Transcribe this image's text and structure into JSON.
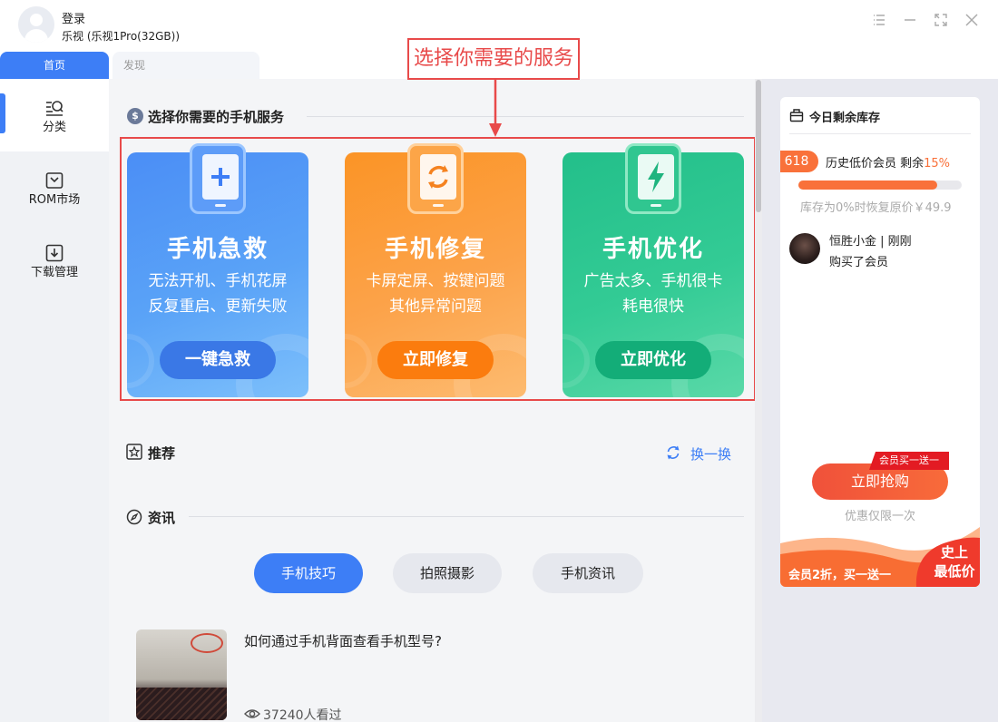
{
  "header": {
    "login_label": "登录",
    "device_label": "乐视 (乐视1Pro(32GB))",
    "controls": [
      "menu-icon",
      "minimize-icon",
      "maximize-icon",
      "close-icon"
    ]
  },
  "tabs": [
    {
      "label": "首页",
      "active": true
    },
    {
      "label": "发现",
      "active": false
    }
  ],
  "sidebar": {
    "items": [
      {
        "label": "分类",
        "icon": "category-search-icon",
        "active": true
      },
      {
        "label": "ROM市场",
        "icon": "rom-market-icon",
        "active": false
      },
      {
        "label": "下载管理",
        "icon": "download-icon",
        "active": false
      }
    ]
  },
  "services": {
    "section_title": "选择你需要的手机服务",
    "cards": [
      {
        "title": "手机急救",
        "desc_lines": [
          "无法开机、手机花屏",
          "反复重启、更新失败"
        ],
        "button": "一键急救",
        "icon": "plus-phone-icon",
        "color": "#4a8ff7"
      },
      {
        "title": "手机修复",
        "desc_lines": [
          "卡屏定屏、按键问题",
          "其他异常问题"
        ],
        "button": "立即修复",
        "icon": "repair-phone-icon",
        "color": "#fb9a2e"
      },
      {
        "title": "手机优化",
        "desc_lines": [
          "广告太多、手机很卡",
          "耗电很快"
        ],
        "button": "立即优化",
        "icon": "bolt-phone-icon",
        "color": "#2dc38e"
      }
    ]
  },
  "annotation": {
    "label": "选择你需要的服务",
    "color": "#e84a4a"
  },
  "recommend": {
    "title": "推荐",
    "refresh_label": "换一换"
  },
  "news": {
    "title": "资讯",
    "chips": [
      {
        "label": "手机技巧",
        "active": true
      },
      {
        "label": "拍照摄影",
        "active": false
      },
      {
        "label": "手机资讯",
        "active": false
      }
    ],
    "items": [
      {
        "title": "如何通过手机背面查看手机型号?",
        "views": "37240人看过"
      }
    ]
  },
  "stock_panel": {
    "title": "今日剩余库存",
    "badge": "618",
    "vip_text": "历史低价会员 剩余",
    "remaining_percent": "15%",
    "remaining_fraction": 0.85,
    "restore_text": "库存为0%时恢复原价￥49.9",
    "buyer_name": "恒胜小金 | 刚刚",
    "buyer_action": "购买了会员",
    "promo_tag": "会员买一送一",
    "buy_button": "立即抢购",
    "limit_text": "优惠仅限一次",
    "slogan": "会员2折，买一送一",
    "lowest_line1": "史上",
    "lowest_line2": "最低价",
    "accent": "#f9713a"
  }
}
